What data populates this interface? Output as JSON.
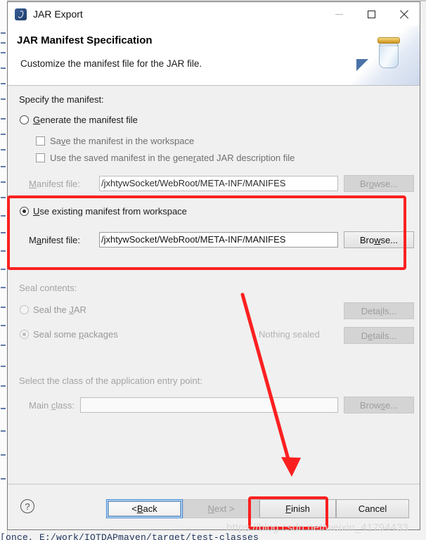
{
  "window": {
    "title": "JAR Export",
    "app_icon": "jar-export-icon",
    "controls": {
      "minimize": "minimize-icon",
      "maximize": "maximize-icon",
      "close": "close-icon"
    }
  },
  "header": {
    "title": "JAR Manifest Specification",
    "subtitle": "Customize the manifest file for the JAR file.",
    "art_icon": "jar-illustration"
  },
  "form": {
    "specify_label": "Specify the manifest:",
    "generate": {
      "radio_label": "Generate the manifest file",
      "selected": false,
      "save_workspace_label": "Save the manifest in the workspace",
      "save_workspace_checked": false,
      "use_saved_label": "Use the saved manifest in the generated JAR description file",
      "use_saved_checked": false,
      "manifest_file_label": "Manifest file:",
      "manifest_file_value": "/jxhtywSocket/WebRoot/META-INF/MANIFES",
      "browse_label": "Browse...",
      "browse_enabled": false
    },
    "existing": {
      "radio_label": "Use existing manifest from workspace",
      "selected": true,
      "manifest_file_label": "Manifest file:",
      "manifest_file_value": "/jxhtywSocket/WebRoot/META-INF/MANIFES",
      "browse_label": "Browse...",
      "browse_enabled": true
    },
    "seal": {
      "section_label": "Seal contents:",
      "seal_jar_label": "Seal the JAR",
      "seal_jar_selected": false,
      "seal_packages_label": "Seal some packages",
      "seal_packages_selected": true,
      "nothing_sealed_label": "Nothing sealed",
      "details_jar_label": "Details...",
      "details_packages_label": "Details..."
    },
    "entry_point": {
      "section_label": "Select the class of the application entry point:",
      "main_class_label": "Main class:",
      "main_class_value": "",
      "browse_label": "Browse..."
    }
  },
  "footer": {
    "help_icon": "help-icon",
    "back_label": "< Back",
    "back_enabled": true,
    "next_label": "Next >",
    "next_enabled": false,
    "finish_label": "Finish",
    "finish_enabled": true,
    "cancel_label": "Cancel",
    "cancel_enabled": true
  },
  "annotations": {
    "watermark": "https://blog.csdn.net/weixin_41794433",
    "highlight_existing_manifest": "red-box-around-use-existing-manifest",
    "highlight_finish": "red-box-around-finish-button",
    "arrow": "red-arrow-pointing-to-finish"
  },
  "background": {
    "bottom_text": "[once, E:/work/IOTDAPmaven/target/test-classes"
  },
  "colors": {
    "annotation_red": "#fb2020",
    "focus_blue": "#2b7cd3",
    "dialog_bg": "#f0f0f0"
  }
}
